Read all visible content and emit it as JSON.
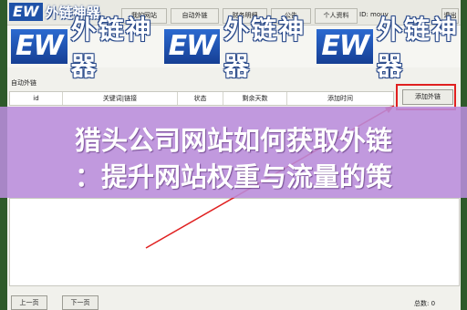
{
  "brand": {
    "logo_latin": "EW",
    "logo_cn": "外链神器"
  },
  "nav_tabs": [
    {
      "label": "我的网站"
    },
    {
      "label": "自动外链"
    },
    {
      "label": "财务明细"
    },
    {
      "label": "公告"
    },
    {
      "label": "个人资料"
    }
  ],
  "user": {
    "id_text": "ID: mouv"
  },
  "quit_label": "退出",
  "banner": {
    "logo_latin": "EW",
    "logo_cn": "外链神器"
  },
  "section": {
    "title": "自动外链"
  },
  "table": {
    "columns": [
      "id",
      "关键词|链接",
      "状态",
      "剩余天数",
      "添加时间"
    ]
  },
  "add_button": "添加外链",
  "promo": {
    "line1": "猎头公司网站如何获取外链",
    "line2": "：提升网站权重与流量的策"
  },
  "pager": {
    "prev": "上一页",
    "next": "下一页",
    "total": "总数: 0"
  },
  "colors": {
    "accent": "#1f52a8",
    "highlight": "#e02020",
    "overlay": "#ba8cdc"
  }
}
